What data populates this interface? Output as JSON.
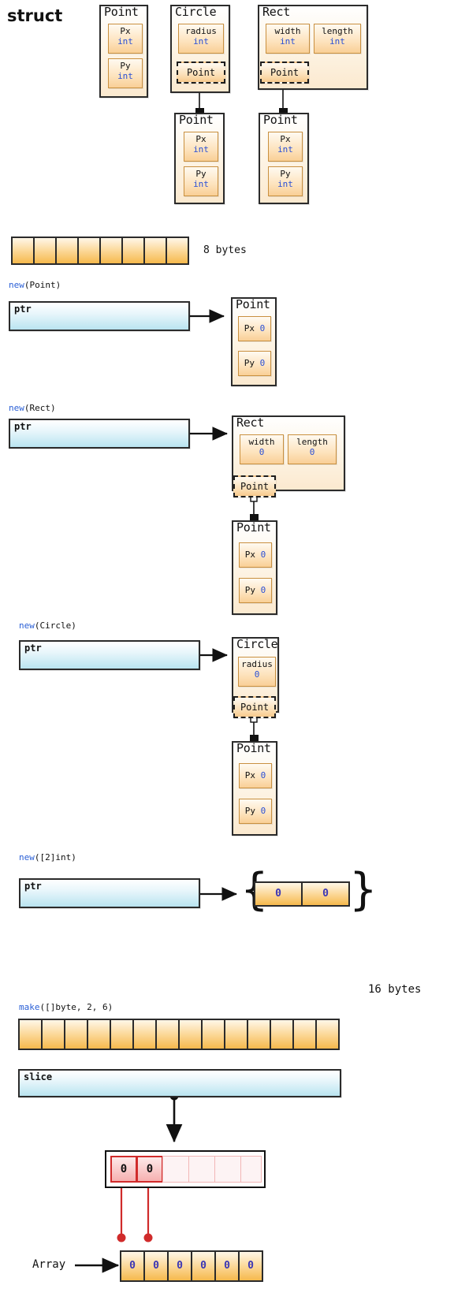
{
  "title": "struct",
  "struct_section": {
    "point": {
      "name": "Point",
      "fields": [
        {
          "name": "Px",
          "type": "int"
        },
        {
          "name": "Py",
          "type": "int"
        }
      ]
    },
    "circle": {
      "name": "Circle",
      "fields": [
        {
          "name": "radius",
          "type": "int"
        }
      ],
      "embedded": "Point"
    },
    "circle_point": {
      "name": "Point",
      "fields": [
        {
          "name": "Px",
          "type": "int"
        },
        {
          "name": "Py",
          "type": "int"
        }
      ]
    },
    "rect": {
      "name": "Rect",
      "fields": [
        {
          "name": "width",
          "type": "int"
        },
        {
          "name": "length",
          "type": "int"
        }
      ],
      "embedded": "Point"
    },
    "rect_point": {
      "name": "Point",
      "fields": [
        {
          "name": "Px",
          "type": "int"
        },
        {
          "name": "Py",
          "type": "int"
        }
      ]
    }
  },
  "bytes8": {
    "label": "8 bytes",
    "cells": 8
  },
  "new_point": {
    "code_kw": "new",
    "code_rest": "(Point)",
    "ptr_label": "ptr",
    "box": {
      "name": "Point",
      "fields": [
        {
          "name": "Px",
          "value": "0"
        },
        {
          "name": "Py",
          "value": "0"
        }
      ]
    }
  },
  "new_rect": {
    "code_kw": "new",
    "code_rest": "(Rect)",
    "ptr_label": "ptr",
    "box": {
      "name": "Rect",
      "fields": [
        {
          "name": "width",
          "value": "0"
        },
        {
          "name": "length",
          "value": "0"
        }
      ],
      "embedded": "Point"
    },
    "point": {
      "name": "Point",
      "fields": [
        {
          "name": "Px",
          "value": "0"
        },
        {
          "name": "Py",
          "value": "0"
        }
      ]
    }
  },
  "new_circle": {
    "code_kw": "new",
    "code_rest": "(Circle)",
    "ptr_label": "ptr",
    "box": {
      "name": "Circle",
      "fields": [
        {
          "name": "radius",
          "value": "0"
        }
      ],
      "embedded": "Point"
    },
    "point": {
      "name": "Point",
      "fields": [
        {
          "name": "Px",
          "value": "0"
        },
        {
          "name": "Py",
          "value": "0"
        }
      ]
    }
  },
  "new_array": {
    "code_kw": "new",
    "code_rest": "([2]int)",
    "ptr_label": "ptr",
    "brace_open": "{",
    "brace_close": "}",
    "cells": [
      "0",
      "0"
    ]
  },
  "make_slice": {
    "code_kw": "make",
    "code_rest": "([]byte, 2, 6)",
    "bytes_label": "16 bytes",
    "bytes_cells": 14,
    "slice_label": "slice",
    "window_cells": [
      "0",
      "0",
      "",
      "",
      "",
      ""
    ],
    "window_active": 2,
    "array_label": "Array",
    "array_cells": [
      "0",
      "0",
      "0",
      "0",
      "0",
      "0"
    ]
  }
}
